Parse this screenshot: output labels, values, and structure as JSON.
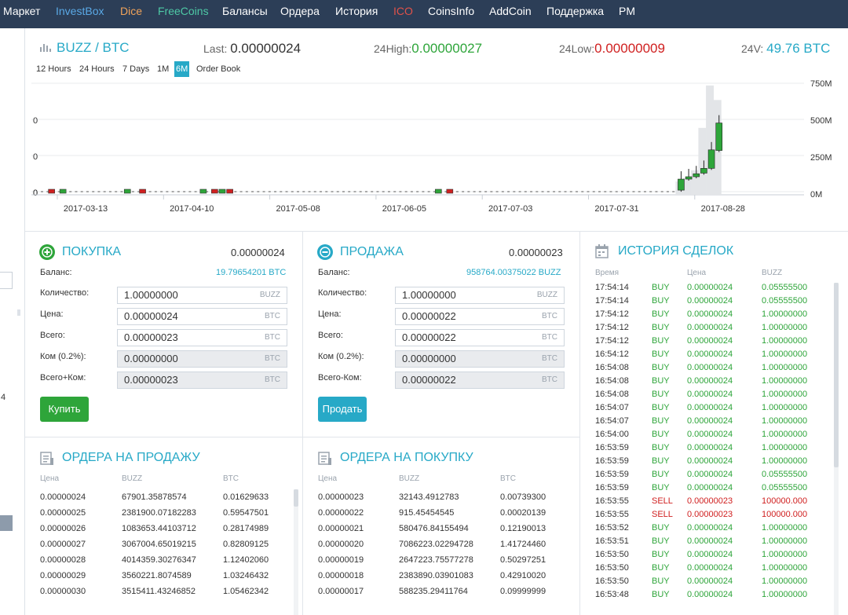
{
  "nav": {
    "items": [
      {
        "label": "Маркет",
        "color": "#ffffff"
      },
      {
        "label": "InvestBox",
        "color": "#5aa9e6"
      },
      {
        "label": "Dice",
        "color": "#f0a35a"
      },
      {
        "label": "FreeCoins",
        "color": "#4ec9a6"
      },
      {
        "label": "Балансы",
        "color": "#ffffff"
      },
      {
        "label": "Ордера",
        "color": "#ffffff"
      },
      {
        "label": "История",
        "color": "#ffffff"
      },
      {
        "label": "ICO",
        "color": "#e0524a"
      },
      {
        "label": "CoinsInfo",
        "color": "#ffffff"
      },
      {
        "label": "AddCoin",
        "color": "#ffffff"
      },
      {
        "label": "Поддержка",
        "color": "#ffffff"
      },
      {
        "label": "PM",
        "color": "#ffffff"
      }
    ]
  },
  "left_strip": {
    "number": "4"
  },
  "market": {
    "pair": "BUZZ / BTC",
    "last_label": "Last:",
    "last_value": "0.00000024",
    "high_label": "24High:",
    "high_value": "0.00000027",
    "low_label": "24Low:",
    "low_value": "0.00000009",
    "vol_label": "24V:",
    "vol_value": "49.76 BTC"
  },
  "tabs": [
    {
      "label": "12 Hours",
      "active": false
    },
    {
      "label": "24 Hours",
      "active": false
    },
    {
      "label": "7 Days",
      "active": false
    },
    {
      "label": "1M",
      "active": false
    },
    {
      "label": "6M",
      "active": true
    },
    {
      "label": "Order Book",
      "active": false
    }
  ],
  "chart_data": {
    "type": "candlestick",
    "x_ticks": [
      "2017-03-13",
      "2017-04-10",
      "2017-05-08",
      "2017-06-05",
      "2017-07-03",
      "2017-07-31",
      "2017-08-28"
    ],
    "y_left_ticks": [
      "0",
      "0",
      "0",
      "0"
    ],
    "y_right_ticks": [
      "750M",
      "500M",
      "250M",
      "0M"
    ],
    "volume_range": [
      0,
      750
    ],
    "colors": {
      "up": "#2ea53a",
      "down": "#d02020",
      "volume": "#e3e5e8"
    },
    "big_candles": [
      {
        "day": 168,
        "open": 0.05,
        "close": 0.42,
        "volume": 0.12
      },
      {
        "day": 170,
        "open": 0.42,
        "close": 0.5,
        "volume": 0.15
      },
      {
        "day": 172,
        "open": 0.5,
        "close": 0.6,
        "volume": 0.22
      },
      {
        "day": 174,
        "open": 0.62,
        "close": 0.78,
        "volume": 0.6
      },
      {
        "day": 176,
        "open": 0.78,
        "close": 1.4,
        "volume": 0.98
      },
      {
        "day": 178,
        "open": 1.38,
        "close": 2.3,
        "volume": 0.85
      }
    ],
    "small_candles": [
      {
        "day": 2,
        "dir": "down"
      },
      {
        "day": 5,
        "dir": "up"
      },
      {
        "day": 22,
        "dir": "up"
      },
      {
        "day": 26,
        "dir": "down"
      },
      {
        "day": 42,
        "dir": "up"
      },
      {
        "day": 45,
        "dir": "down"
      },
      {
        "day": 47,
        "dir": "up"
      },
      {
        "day": 49,
        "dir": "down"
      },
      {
        "day": 104,
        "dir": "up"
      },
      {
        "day": 107,
        "dir": "down"
      }
    ]
  },
  "buy": {
    "title": "ПОКУПКА",
    "price": "0.00000024",
    "balance_label": "Баланс:",
    "balance_value": "19.79654201 BTC",
    "qty_label": "Количество:",
    "qty_value": "1.00000000",
    "qty_unit": "BUZZ",
    "price_label": "Цена:",
    "price_value": "0.00000024",
    "price_unit": "BTC",
    "total_label": "Всего:",
    "total_value": "0.00000023",
    "total_unit": "BTC",
    "fee_label": "Ком (0.2%):",
    "fee_value": "0.00000000",
    "fee_unit": "BTC",
    "tf_label": "Всего+Ком:",
    "tf_value": "0.00000023",
    "tf_unit": "BTC",
    "button": "Купить"
  },
  "sell": {
    "title": "ПРОДАЖА",
    "price": "0.00000023",
    "balance_label": "Баланс:",
    "balance_value": "958764.00375022 BUZZ",
    "qty_label": "Количество:",
    "qty_value": "1.00000000",
    "qty_unit": "BUZZ",
    "price_label": "Цена:",
    "price_value": "0.00000022",
    "price_unit": "BTC",
    "total_label": "Всего:",
    "total_value": "0.00000022",
    "total_unit": "BTC",
    "fee_label": "Ком (0.2%):",
    "fee_value": "0.00000000",
    "fee_unit": "BTC",
    "tf_label": "Всего-Ком:",
    "tf_value": "0.00000022",
    "tf_unit": "BTC",
    "button": "Продать"
  },
  "sell_orders": {
    "title": "ОРДЕРА НА ПРОДАЖУ",
    "headers": [
      "Цена",
      "BUZZ",
      "BTC"
    ],
    "rows": [
      [
        "0.00000024",
        "67901.35878574",
        "0.01629633"
      ],
      [
        "0.00000025",
        "2381900.07182283",
        "0.59547501"
      ],
      [
        "0.00000026",
        "1083653.44103712",
        "0.28174989"
      ],
      [
        "0.00000027",
        "3067004.65019215",
        "0.82809125"
      ],
      [
        "0.00000028",
        "4014359.30276347",
        "1.12402060"
      ],
      [
        "0.00000029",
        "3560221.8074589",
        "1.03246432"
      ],
      [
        "0.00000030",
        "3515411.43246852",
        "1.05462342"
      ]
    ]
  },
  "buy_orders": {
    "title": "ОРДЕРА НА ПОКУПКУ",
    "headers": [
      "Цена",
      "BUZZ",
      "BTC"
    ],
    "rows": [
      [
        "0.00000023",
        "32143.4912783",
        "0.00739300"
      ],
      [
        "0.00000022",
        "915.45454545",
        "0.00020139"
      ],
      [
        "0.00000021",
        "580476.84155494",
        "0.12190013"
      ],
      [
        "0.00000020",
        "7086223.02294728",
        "1.41724460"
      ],
      [
        "0.00000019",
        "2647223.75577278",
        "0.50297251"
      ],
      [
        "0.00000018",
        "2383890.03901083",
        "0.42910020"
      ],
      [
        "0.00000017",
        "588235.29411764",
        "0.09999999"
      ]
    ]
  },
  "history": {
    "title": "ИСТОРИЯ СДЕЛОК",
    "headers": [
      "Время",
      "Цена",
      "BUZZ"
    ],
    "rows": [
      [
        "17:54:14",
        "BUY",
        "0.00000024",
        "0.05555500"
      ],
      [
        "17:54:14",
        "BUY",
        "0.00000024",
        "0.05555500"
      ],
      [
        "17:54:12",
        "BUY",
        "0.00000024",
        "1.00000000"
      ],
      [
        "17:54:12",
        "BUY",
        "0.00000024",
        "1.00000000"
      ],
      [
        "17:54:12",
        "BUY",
        "0.00000024",
        "1.00000000"
      ],
      [
        "16:54:12",
        "BUY",
        "0.00000024",
        "1.00000000"
      ],
      [
        "16:54:08",
        "BUY",
        "0.00000024",
        "1.00000000"
      ],
      [
        "16:54:08",
        "BUY",
        "0.00000024",
        "1.00000000"
      ],
      [
        "16:54:08",
        "BUY",
        "0.00000024",
        "1.00000000"
      ],
      [
        "16:54:07",
        "BUY",
        "0.00000024",
        "1.00000000"
      ],
      [
        "16:54:07",
        "BUY",
        "0.00000024",
        "1.00000000"
      ],
      [
        "16:54:00",
        "BUY",
        "0.00000024",
        "1.00000000"
      ],
      [
        "16:53:59",
        "BUY",
        "0.00000024",
        "1.00000000"
      ],
      [
        "16:53:59",
        "BUY",
        "0.00000024",
        "1.00000000"
      ],
      [
        "16:53:59",
        "BUY",
        "0.00000024",
        "0.05555500"
      ],
      [
        "16:53:59",
        "BUY",
        "0.00000024",
        "0.05555500"
      ],
      [
        "16:53:55",
        "SELL",
        "0.00000023",
        "100000.000"
      ],
      [
        "16:53:55",
        "SELL",
        "0.00000023",
        "100000.000"
      ],
      [
        "16:53:52",
        "BUY",
        "0.00000024",
        "1.00000000"
      ],
      [
        "16:53:51",
        "BUY",
        "0.00000024",
        "1.00000000"
      ],
      [
        "16:53:50",
        "BUY",
        "0.00000024",
        "1.00000000"
      ],
      [
        "16:53:50",
        "BUY",
        "0.00000024",
        "1.00000000"
      ],
      [
        "16:53:50",
        "BUY",
        "0.00000024",
        "1.00000000"
      ],
      [
        "16:53:48",
        "BUY",
        "0.00000024",
        "1.00000000"
      ]
    ]
  }
}
